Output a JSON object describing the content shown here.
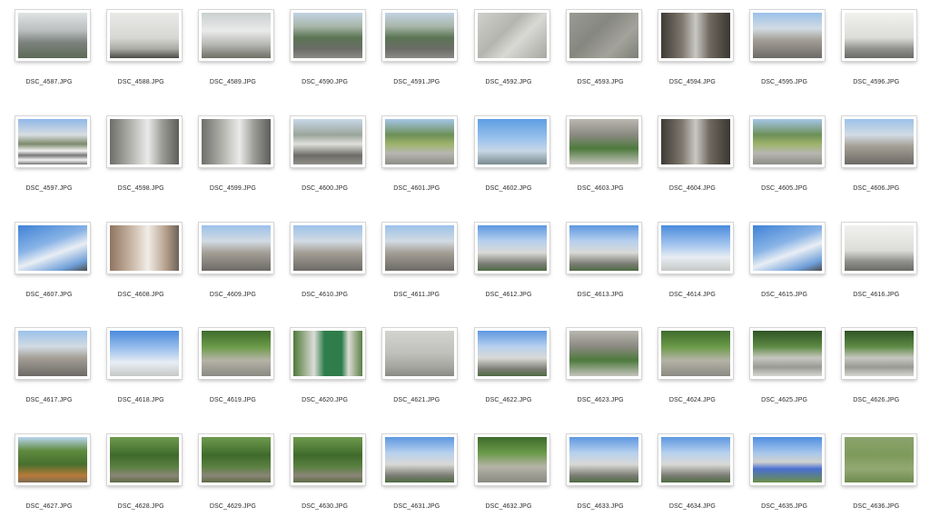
{
  "files": [
    {
      "name": "DSC_4587.JPG",
      "scene": "street-alley"
    },
    {
      "name": "DSC_4588.JPG",
      "scene": "wall-bicycle"
    },
    {
      "name": "DSC_4589.JPG",
      "scene": "courtyard"
    },
    {
      "name": "DSC_4590.JPG",
      "scene": "street-green"
    },
    {
      "name": "DSC_4591.JPG",
      "scene": "street-green"
    },
    {
      "name": "DSC_4592.JPG",
      "scene": "pavement"
    },
    {
      "name": "DSC_4593.JPG",
      "scene": "pavement-dark"
    },
    {
      "name": "DSC_4594.JPG",
      "scene": "alley-dark"
    },
    {
      "name": "DSC_4595.JPG",
      "scene": "street-sky"
    },
    {
      "name": "DSC_4596.JPG",
      "scene": "wall-white"
    },
    {
      "name": "DSC_4597.JPG",
      "scene": "crosswalk"
    },
    {
      "name": "DSC_4598.JPG",
      "scene": "street-grey"
    },
    {
      "name": "DSC_4599.JPG",
      "scene": "street-grey"
    },
    {
      "name": "DSC_4600.JPG",
      "scene": "street-truck"
    },
    {
      "name": "DSC_4601.JPG",
      "scene": "street-trees"
    },
    {
      "name": "DSC_4602.JPG",
      "scene": "sky-sign"
    },
    {
      "name": "DSC_4603.JPG",
      "scene": "building-green"
    },
    {
      "name": "DSC_4604.JPG",
      "scene": "alley-dark"
    },
    {
      "name": "DSC_4605.JPG",
      "scene": "street-trees"
    },
    {
      "name": "DSC_4606.JPG",
      "scene": "street-sky"
    },
    {
      "name": "DSC_4607.JPG",
      "scene": "sky-clouds"
    },
    {
      "name": "DSC_4608.JPG",
      "scene": "building-brick"
    },
    {
      "name": "DSC_4609.JPG",
      "scene": "street-sky"
    },
    {
      "name": "DSC_4610.JPG",
      "scene": "street-sky"
    },
    {
      "name": "DSC_4611.JPG",
      "scene": "street-sky"
    },
    {
      "name": "DSC_4612.JPG",
      "scene": "building-sky"
    },
    {
      "name": "DSC_4613.JPG",
      "scene": "building-sky"
    },
    {
      "name": "DSC_4614.JPG",
      "scene": "sky-wires"
    },
    {
      "name": "DSC_4615.JPG",
      "scene": "sky-clouds"
    },
    {
      "name": "DSC_4616.JPG",
      "scene": "wall-white"
    },
    {
      "name": "DSC_4617.JPG",
      "scene": "street-sky"
    },
    {
      "name": "DSC_4618.JPG",
      "scene": "sky-wires"
    },
    {
      "name": "DSC_4619.JPG",
      "scene": "park-green"
    },
    {
      "name": "DSC_4620.JPG",
      "scene": "pole-sign"
    },
    {
      "name": "DSC_4621.JPG",
      "scene": "wall-grey"
    },
    {
      "name": "DSC_4622.JPG",
      "scene": "building-sky"
    },
    {
      "name": "DSC_4623.JPG",
      "scene": "building-green"
    },
    {
      "name": "DSC_4624.JPG",
      "scene": "park-green"
    },
    {
      "name": "DSC_4625.JPG",
      "scene": "park-steps"
    },
    {
      "name": "DSC_4626.JPG",
      "scene": "park-steps"
    },
    {
      "name": "DSC_4627.JPG",
      "scene": "park-path"
    },
    {
      "name": "DSC_4628.JPG",
      "scene": "forest-path"
    },
    {
      "name": "DSC_4629.JPG",
      "scene": "forest-path"
    },
    {
      "name": "DSC_4630.JPG",
      "scene": "forest-path"
    },
    {
      "name": "DSC_4631.JPG",
      "scene": "building-sky"
    },
    {
      "name": "DSC_4632.JPG",
      "scene": "park-green"
    },
    {
      "name": "DSC_4633.JPG",
      "scene": "building-sky"
    },
    {
      "name": "DSC_4634.JPG",
      "scene": "building-sky"
    },
    {
      "name": "DSC_4635.JPG",
      "scene": "river-sky"
    },
    {
      "name": "DSC_4636.JPG",
      "scene": "grass-field"
    }
  ]
}
